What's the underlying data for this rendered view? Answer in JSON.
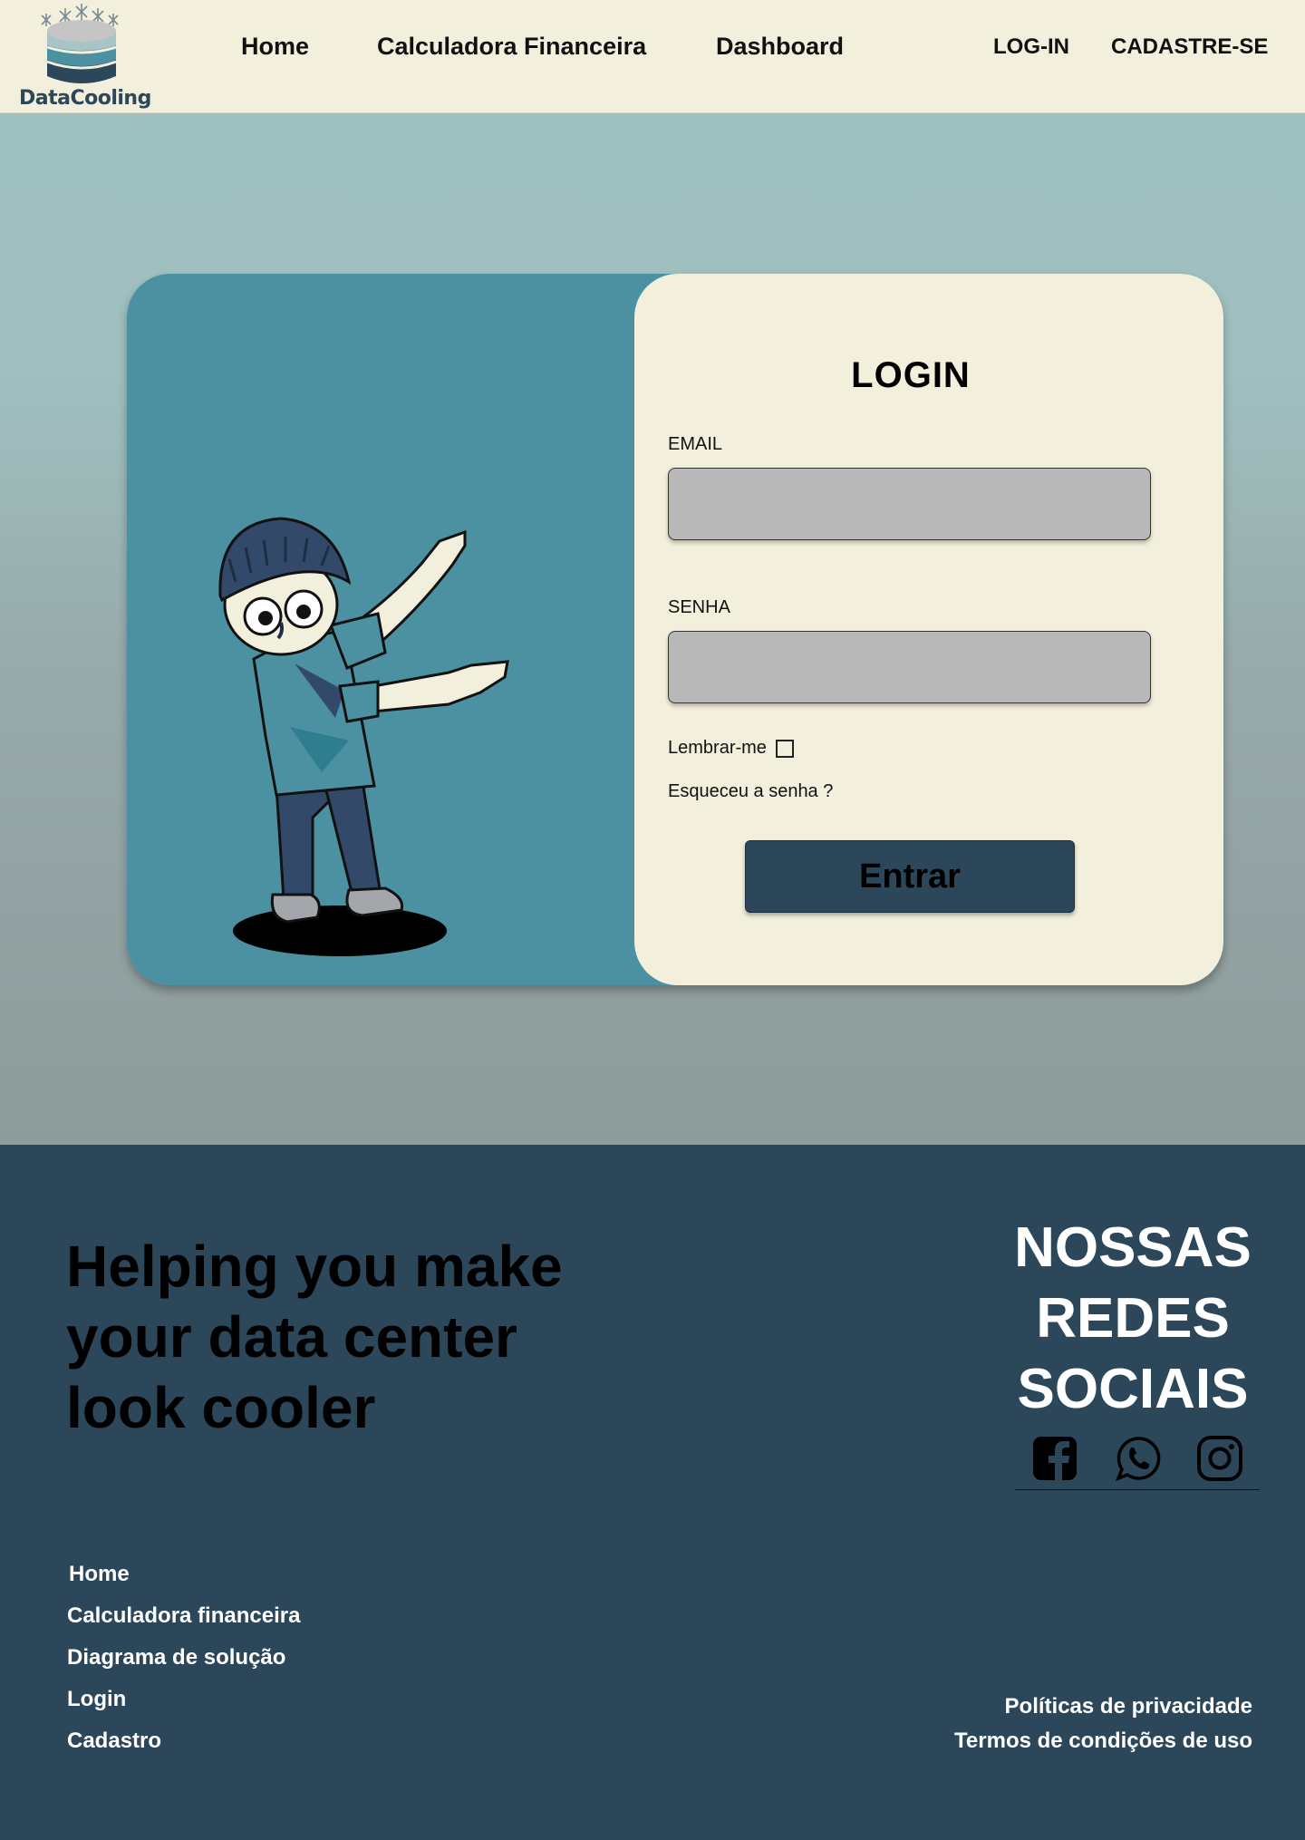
{
  "brand": {
    "name": "DataCooling",
    "logo_icon": "database-snowflake-logo"
  },
  "nav": {
    "links": [
      "Home",
      "Calculadora Financeira",
      "Dashboard"
    ],
    "login": "LOG-IN",
    "signup": "CADASTRE-SE"
  },
  "login": {
    "title": "LOGIN",
    "email_label": "EMAIL",
    "email_value": "",
    "password_label": "SENHA",
    "password_value": "",
    "remember_label": "Lembrar-me",
    "remember_checked": false,
    "forgot_label": "Esqueceu a senha ?",
    "submit_label": "Entrar"
  },
  "footer": {
    "tagline": "Helping you make your data center look cooler",
    "social_title": [
      "NOSSAS",
      "REDES",
      "SOCIAIS"
    ],
    "social_icons": [
      "facebook-icon",
      "whatsapp-icon",
      "instagram-icon"
    ],
    "links": [
      "Home",
      "Calculadora financeira",
      "Diagrama de solução",
      "Login",
      "Cadastro"
    ],
    "legal": [
      "Políticas de privacidade",
      "Termos de condições de uso"
    ]
  },
  "colors": {
    "header_bg": "#f2efdc",
    "hero_top": "#9fc0c1",
    "hero_bottom": "#8e9b9b",
    "card_left": "#4b91a2",
    "card_right": "#f2efdc",
    "input_bg": "#b8b8b8",
    "primary_dark": "#2b4759"
  }
}
